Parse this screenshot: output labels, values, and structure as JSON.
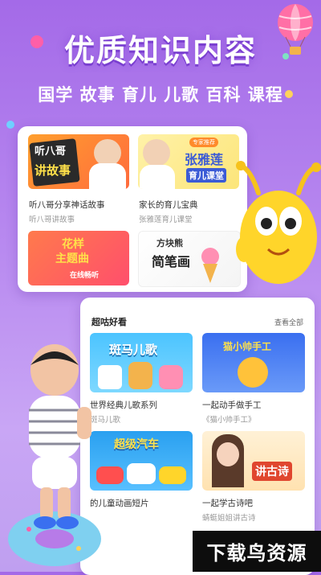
{
  "headline": "优质知识内容",
  "subline": "国学 故事 育儿 儿歌 百科 课程",
  "top_card": {
    "items": [
      {
        "title": "听八哥分享神话故事",
        "sub": "听八哥讲故事",
        "thumb_text_1": "听八哥",
        "thumb_text_2": "讲故事"
      },
      {
        "title": "家长的育儿宝典",
        "sub": "张雅莲育儿课堂",
        "thumb_text_1": "张雅莲",
        "thumb_text_2": "育儿课堂",
        "thumb_badge": "专家推荐"
      },
      {
        "thumb_text_1": "花样",
        "thumb_text_2": "主题曲",
        "thumb_text_3": "在线畅听"
      },
      {
        "thumb_text_1": "方块熊",
        "thumb_text_2": "简笔画"
      }
    ]
  },
  "section": {
    "title": "超咕好看",
    "see_all": "查看全部",
    "items": [
      {
        "title": "世界经典儿歌系列",
        "sub": "斑马儿歌",
        "thumb_text": "斑马儿歌"
      },
      {
        "title": "一起动手做手工",
        "sub": "《猫小帅手工》",
        "thumb_text": "猫小帅手工"
      },
      {
        "title": "的儿童动画短片",
        "sub": "",
        "thumb_text": "超级汽车"
      },
      {
        "title": "一起学古诗吧",
        "sub": "蜻蜓姐姐讲古诗",
        "thumb_text": "讲古诗"
      }
    ]
  },
  "watermark": "下载鸟资源",
  "colors": {
    "bg_top": "#a46ae8",
    "bg_bottom": "#c9a6f5",
    "accent": "#ff5fa8"
  }
}
